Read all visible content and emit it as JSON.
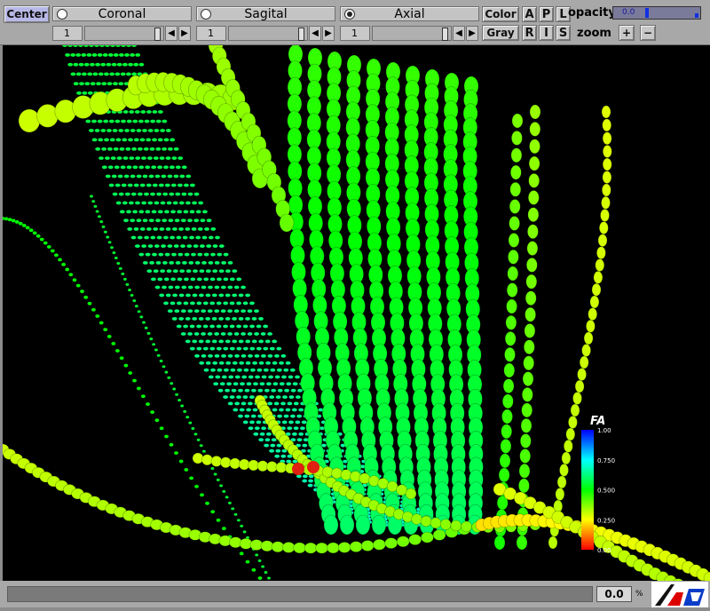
{
  "toolbar": {
    "center_label": "Center",
    "planes": [
      {
        "label": "Coronal",
        "selected": false,
        "slice": "1"
      },
      {
        "label": "Sagital",
        "selected": false,
        "slice": "1"
      },
      {
        "label": "Axial",
        "selected": true,
        "slice": "1"
      }
    ],
    "color_label": "Color",
    "gray_label": "Gray",
    "orient_top": [
      "A",
      "P",
      "L"
    ],
    "orient_bottom": [
      "R",
      "I",
      "S"
    ],
    "opacity_label": "opacity",
    "opacity_value": "0.0",
    "zoom_label": "zoom",
    "zoom_in": "+",
    "zoom_out": "−"
  },
  "colorbar": {
    "title": "FA",
    "ticks": [
      "1.00",
      "0.750",
      "0.500",
      "0.250",
      "0.00"
    ],
    "colors": [
      "#0000ff",
      "#00ffff",
      "#00ff00",
      "#ffff00",
      "#ff0000"
    ]
  },
  "status": {
    "progress_percent": "0.0",
    "percent_sign": "%"
  },
  "icons": {
    "logo": "lpv-logo-icon",
    "prev": "arrow-left-icon",
    "next": "arrow-right-icon"
  }
}
